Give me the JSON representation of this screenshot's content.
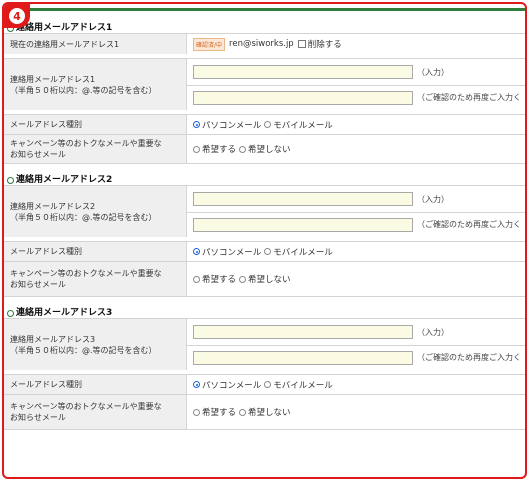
{
  "step_number": "4",
  "sections": [
    {
      "heading": "連絡用メールアドレス1",
      "current_label": "現在の連絡用メールアドレス1",
      "current_status_badge": "確認済/中",
      "current_email": "ren@siworks.jp",
      "delete_label": "削除する",
      "email_label_line1": "連絡用メールアドレス1",
      "email_label_line2": "（半角５０桁以内：@.等の記号を含む）",
      "input_note": "（入力）",
      "confirm_note": "（ご確認のため再度ご入力く",
      "type_label": "メールアドレス種別",
      "type_pc": "パソコンメール",
      "type_mobile": "モバイルメール",
      "promo_label_line1": "キャンペーン等のおトクなメールや重要な",
      "promo_label_line2": "お知らせメール",
      "promo_yes": "希望する",
      "promo_no": "希望しない"
    },
    {
      "heading": "連絡用メールアドレス2",
      "email_label_line1": "連絡用メールアドレス2",
      "email_label_line2": "（半角５０桁以内：@.等の記号を含む）",
      "input_note": "（入力）",
      "confirm_note": "（ご確認のため再度ご入力く",
      "type_label": "メールアドレス種別",
      "type_pc": "パソコンメール",
      "type_mobile": "モバイルメール",
      "promo_label_line1": "キャンペーン等のおトクなメールや重要な",
      "promo_label_line2": "お知らせメール",
      "promo_yes": "希望する",
      "promo_no": "希望しない"
    },
    {
      "heading": "連絡用メールアドレス3",
      "email_label_line1": "連絡用メールアドレス3",
      "email_label_line2": "（半角５０桁以内：@.等の記号を含む）",
      "input_note": "（入力）",
      "confirm_note": "（ご確認のため再度ご入力く",
      "type_label": "メールアドレス種別",
      "type_pc": "パソコンメール",
      "type_mobile": "モバイルメール",
      "promo_label_line1": "キャンペーン等のおトクなメールや重要な",
      "promo_label_line2": "お知らせメール",
      "promo_yes": "希望する",
      "promo_no": "希望しない"
    }
  ],
  "colors": {
    "frame": "#e01a1a",
    "heading_bullet": "#2c7a3e",
    "input_bg": "#fbfbe4",
    "label_bg": "#efefef",
    "radio_selected": "#1a64d4"
  }
}
